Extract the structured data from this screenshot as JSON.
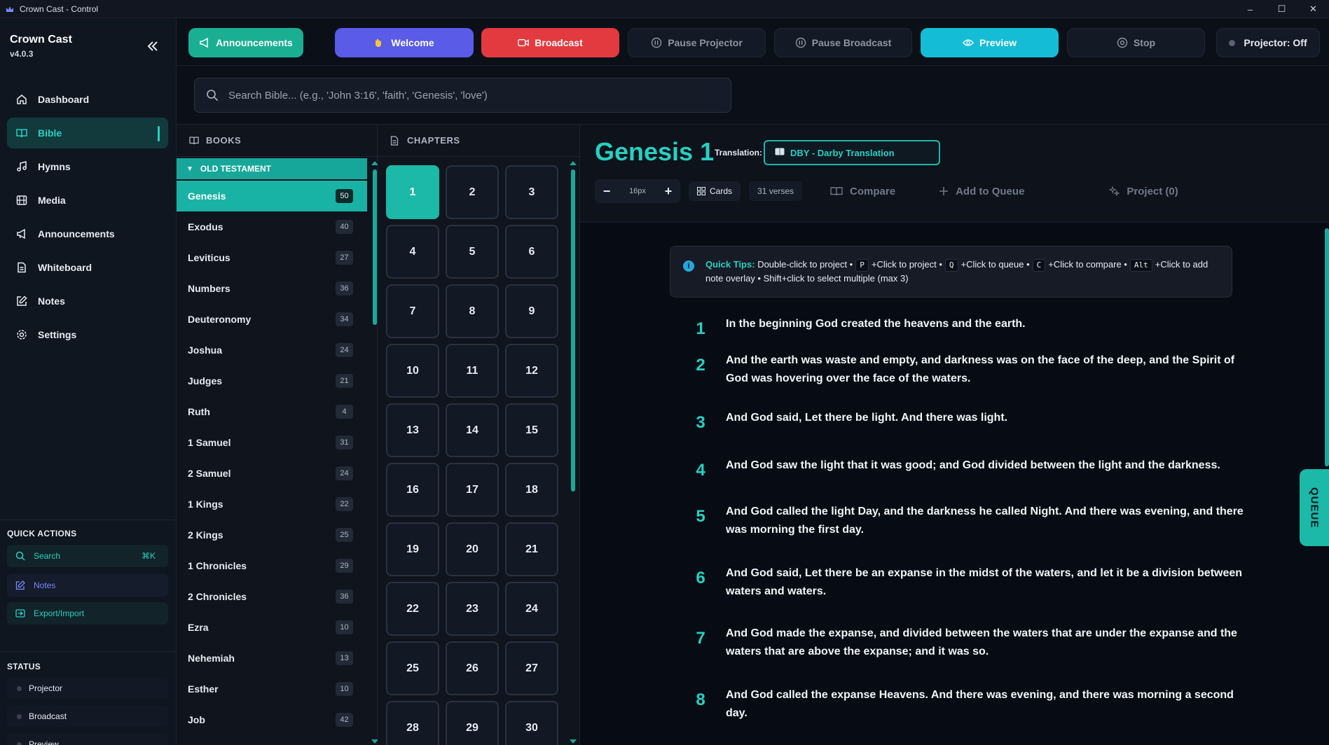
{
  "window": {
    "title": "Crown Cast - Control",
    "controls": [
      "–",
      "☐",
      "✕"
    ]
  },
  "brand": {
    "name": "Crown Cast",
    "version": "v4.0.3"
  },
  "nav": [
    {
      "label": "Dashboard",
      "icon": "home-icon"
    },
    {
      "label": "Bible",
      "icon": "book-icon",
      "active": true
    },
    {
      "label": "Hymns",
      "icon": "music-icon"
    },
    {
      "label": "Media",
      "icon": "film-icon"
    },
    {
      "label": "Announcements",
      "icon": "megaphone-icon"
    },
    {
      "label": "Whiteboard",
      "icon": "file-icon"
    },
    {
      "label": "Notes",
      "icon": "edit-icon"
    },
    {
      "label": "Settings",
      "icon": "gear-icon"
    }
  ],
  "quick_actions": {
    "label": "QUICK ACTIONS",
    "search": "Search",
    "search_kbd": "⌘K",
    "notes": "Notes",
    "export": "Export/Import"
  },
  "status": {
    "label": "STATUS",
    "items": [
      "Projector",
      "Broadcast",
      "Preview"
    ]
  },
  "toolbar": {
    "announcements": "Announcements",
    "welcome": "Welcome",
    "broadcast": "Broadcast",
    "pause_projector": "Pause Projector",
    "pause_broadcast": "Pause Broadcast",
    "preview": "Preview",
    "stop": "Stop",
    "projector_status": "Projector: Off"
  },
  "search": {
    "placeholder": "Search Bible... (e.g., 'John 3:16', 'faith', 'Genesis', 'love')"
  },
  "books_panel": {
    "header": "BOOKS",
    "testament": "OLD TESTAMENT",
    "books": [
      {
        "name": "Genesis",
        "count": "50",
        "active": true
      },
      {
        "name": "Exodus",
        "count": "40"
      },
      {
        "name": "Leviticus",
        "count": "27"
      },
      {
        "name": "Numbers",
        "count": "36"
      },
      {
        "name": "Deuteronomy",
        "count": "34"
      },
      {
        "name": "Joshua",
        "count": "24"
      },
      {
        "name": "Judges",
        "count": "21"
      },
      {
        "name": "Ruth",
        "count": "4"
      },
      {
        "name": "1 Samuel",
        "count": "31"
      },
      {
        "name": "2 Samuel",
        "count": "24"
      },
      {
        "name": "1 Kings",
        "count": "22"
      },
      {
        "name": "2 Kings",
        "count": "25"
      },
      {
        "name": "1 Chronicles",
        "count": "29"
      },
      {
        "name": "2 Chronicles",
        "count": "36"
      },
      {
        "name": "Ezra",
        "count": "10"
      },
      {
        "name": "Nehemiah",
        "count": "13"
      },
      {
        "name": "Esther",
        "count": "10"
      },
      {
        "name": "Job",
        "count": "42"
      }
    ]
  },
  "chapters_panel": {
    "header": "CHAPTERS",
    "chapters": [
      "1",
      "2",
      "3",
      "4",
      "5",
      "6",
      "7",
      "8",
      "9",
      "10",
      "11",
      "12",
      "13",
      "14",
      "15",
      "16",
      "17",
      "18",
      "19",
      "20",
      "21",
      "22",
      "23",
      "24",
      "25",
      "26",
      "27",
      "28",
      "29",
      "30"
    ],
    "active": "1"
  },
  "main": {
    "title": "Genesis 1",
    "translation_label": "Translation:",
    "translation": "DBY - Darby Translation",
    "font_size": "16px",
    "view_mode": "Cards",
    "verse_count": "31 verses",
    "compare": "Compare",
    "add_to_queue": "Add to Queue",
    "project": "Project (0)",
    "tips": {
      "lead": "Quick Tips:",
      "t1": "Double-click to project •",
      "k1": "P",
      "t2": "+Click to project •",
      "k2": "Q",
      "t3": "+Click to queue •",
      "k3": "C",
      "t4": "+Click to compare •",
      "k4": "Alt",
      "t5": "+Click to add note overlay • Shift+click to select multiple (max 3)"
    },
    "verses": [
      {
        "num": "1",
        "text": "In the beginning God created the heavens and the earth."
      },
      {
        "num": "2",
        "text": "And the earth was waste and empty, and darkness was on the face of the deep, and the Spirit of God was hovering over the face of the waters."
      },
      {
        "num": "3",
        "text": "And God said, Let there be light. And there was light."
      },
      {
        "num": "4",
        "text": "And God saw the light that it was good; and God divided between the light and the darkness."
      },
      {
        "num": "5",
        "text": "And God called the light Day, and the darkness he called Night. And there was evening, and there was morning the first day."
      },
      {
        "num": "6",
        "text": "And God said, Let there be an expanse in the midst of the waters, and let it be a division between waters and waters."
      },
      {
        "num": "7",
        "text": "And God made the expanse, and divided between the waters that are under the expanse and the waters that are above the expanse; and it was so."
      },
      {
        "num": "8",
        "text": "And God called the expanse Heavens. And there was evening, and there was morning a second day."
      }
    ],
    "queue_tab": "QUEUE"
  },
  "colors": {
    "accent": "#26d0c2",
    "announce": "#1aaf93",
    "welcome": "#5a5be6",
    "broadcast": "#e23a3f",
    "preview": "#15bcd6"
  }
}
